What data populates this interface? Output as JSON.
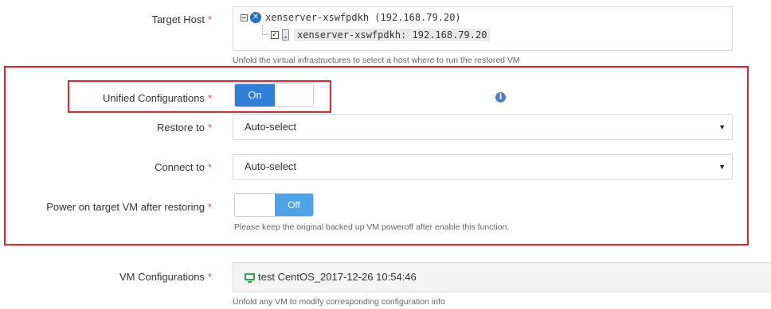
{
  "target_host": {
    "label": "Target Host",
    "required_mark": "*",
    "tree": {
      "pool_label": "xenserver-xswfpdkh (192.168.79.20)",
      "host_label": "xenserver-xswfpdkh: 192.168.79.20",
      "host_checked": true,
      "pool_expanded_symbol": "minus-box-icon",
      "pool_icon": "xenserver-icon",
      "host_icon": "vm-host-icon"
    },
    "hint": "Unfold the virtual infrastructures to select a host where to run the restored VM"
  },
  "unified_configurations": {
    "label": "Unified Configurations",
    "required_mark": "*",
    "toggle_state": "On",
    "info_icon": "info-icon"
  },
  "restore_to": {
    "label": "Restore to",
    "required_mark": "*",
    "selected": "Auto-select"
  },
  "connect_to": {
    "label": "Connect to",
    "required_mark": "*",
    "selected": "Auto-select"
  },
  "power_on": {
    "label": "Power on target VM after restoring",
    "required_mark": "*",
    "toggle_state": "Off",
    "hint": "Please keep the original backed up VM poweroff after enable this function."
  },
  "vm_configurations": {
    "label": "VM Configurations",
    "required_mark": "*",
    "vm_icon": "monitor-icon",
    "vm_name": "test CentOS_2017-12-26 10:54:46",
    "hint": "Unfold any VM to modify corresponding configuration info"
  },
  "colors": {
    "highlight_border": "#e8212a",
    "toggle_on": "#2f7ed8",
    "toggle_off": "#4ea2e6",
    "required": "#e74c3c"
  }
}
